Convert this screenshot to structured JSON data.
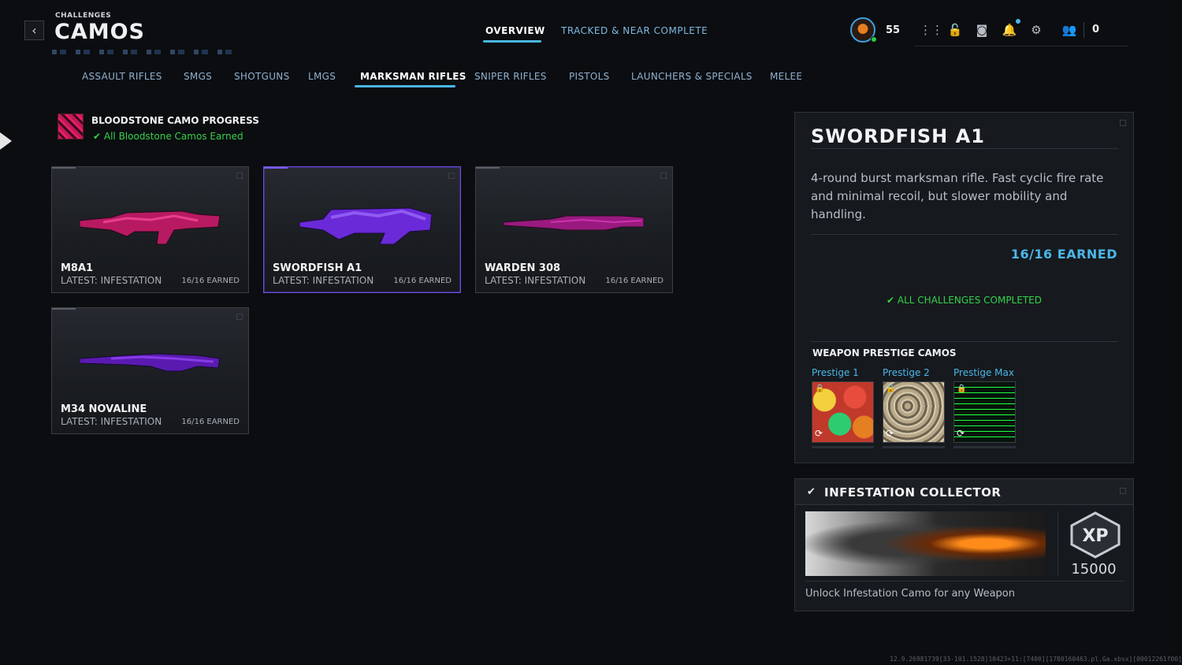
{
  "header": {
    "crumb": "CHALLENGES",
    "title": "CAMOS",
    "tabs": [
      {
        "label": "OVERVIEW",
        "active": true
      },
      {
        "label": "TRACKED & NEAR COMPLETE",
        "active": false
      }
    ],
    "level": "55",
    "currency": "0"
  },
  "categories": [
    "ASSAULT RIFLES",
    "SMGS",
    "SHOTGUNS",
    "LMGS",
    "MARKSMAN RIFLES",
    "SNIPER RIFLES",
    "PISTOLS",
    "LAUNCHERS & SPECIALS",
    "MELEE"
  ],
  "progress": {
    "title": "BLOODSTONE CAMO PROGRESS",
    "status": "All Bloodstone Camos Earned"
  },
  "weapons": [
    {
      "name": "M8A1",
      "latest": "LATEST: INFESTATION",
      "earned": "16/16 EARNED",
      "camo_color": "#e0207a"
    },
    {
      "name": "SWORDFISH A1",
      "latest": "LATEST: INFESTATION",
      "earned": "16/16 EARNED",
      "camo_color": "#8a3cff"
    },
    {
      "name": "WARDEN 308",
      "latest": "LATEST: INFESTATION",
      "earned": "16/16 EARNED",
      "camo_color": "#c02090"
    },
    {
      "name": "M34 NOVALINE",
      "latest": "LATEST: INFESTATION",
      "earned": "16/16 EARNED",
      "camo_color": "#7a2cd8"
    }
  ],
  "detail": {
    "title": "SWORDFISH A1",
    "description": "4-round burst marksman rifle. Fast cyclic fire rate and minimal recoil, but slower mobility and handling.",
    "earned": "16/16 EARNED",
    "complete": "ALL CHALLENGES COMPLETED",
    "prestige_heading": "WEAPON PRESTIGE CAMOS",
    "prestige": [
      {
        "label": "Prestige 1"
      },
      {
        "label": "Prestige 2"
      },
      {
        "label": "Prestige Max"
      }
    ]
  },
  "challenge": {
    "title": "INFESTATION COLLECTOR",
    "xp_label": "XP",
    "xp": "15000",
    "description": "Unlock Infestation Camo for any Weapon"
  },
  "build": "12.9.26981739[33-101.1528]10423+11:[7400][1780160463.pl.Ga.xbsx][00012261f00]"
}
